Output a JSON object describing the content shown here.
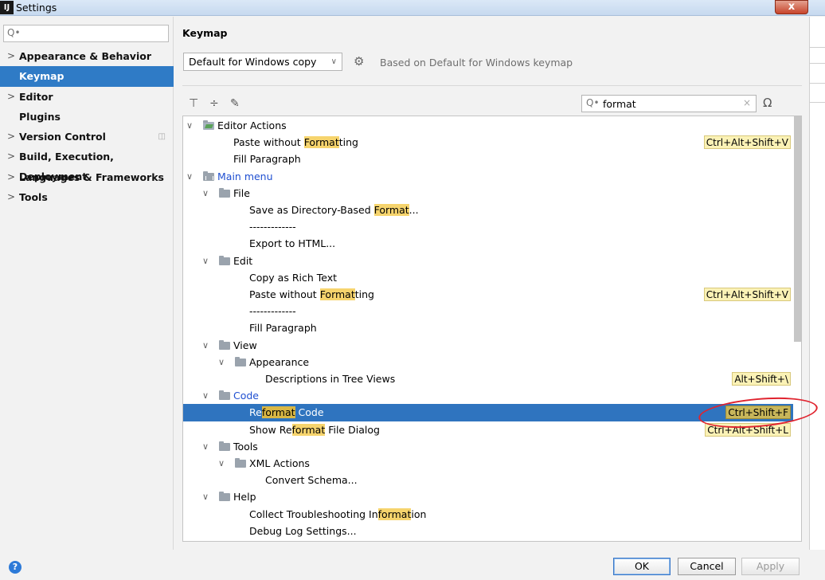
{
  "window": {
    "title": "Settings",
    "app_icon": "IJ",
    "close_glyph": "x"
  },
  "sidebar": {
    "search_icon": "Q•",
    "items": [
      {
        "label": "Appearance & Behavior",
        "chev": ">"
      },
      {
        "label": "Keymap",
        "chev": ""
      },
      {
        "label": "Editor",
        "chev": ">"
      },
      {
        "label": "Plugins",
        "chev": ""
      },
      {
        "label": "Version Control",
        "chev": ">"
      },
      {
        "label": "Build, Execution, Deployment",
        "chev": ">"
      },
      {
        "label": "Languages & Frameworks",
        "chev": ">"
      },
      {
        "label": "Tools",
        "chev": ">"
      }
    ]
  },
  "main": {
    "heading": "Keymap",
    "keymap_select": "Default for Windows copy",
    "based_on": "Based on Default for Windows keymap",
    "search": {
      "icon": "Q•",
      "value": "format"
    }
  },
  "tree": {
    "r0": {
      "chev": "∨",
      "label": "Editor Actions"
    },
    "r1": {
      "pre": "Paste without ",
      "hl": "Format",
      "post": "ting",
      "shortcut": "Ctrl+Alt+Shift+V"
    },
    "r2": {
      "label": "Fill Paragraph"
    },
    "r3": {
      "chev": "∨",
      "label": "Main menu"
    },
    "r4": {
      "chev": "∨",
      "label": "File"
    },
    "r5": {
      "pre": "Save as Directory-Based ",
      "hl": "Format",
      "post": "..."
    },
    "r6": {
      "label": "-------------"
    },
    "r7": {
      "label": "Export to HTML..."
    },
    "r8": {
      "chev": "∨",
      "label": "Edit"
    },
    "r9": {
      "label": "Copy as Rich Text"
    },
    "r10": {
      "pre": "Paste without ",
      "hl": "Format",
      "post": "ting",
      "shortcut": "Ctrl+Alt+Shift+V"
    },
    "r11": {
      "label": "-------------"
    },
    "r12": {
      "label": "Fill Paragraph"
    },
    "r13": {
      "chev": "∨",
      "label": "View"
    },
    "r14": {
      "chev": "∨",
      "label": "Appearance"
    },
    "r15": {
      "label": "Descriptions in Tree Views",
      "shortcut": "Alt+Shift+\\"
    },
    "r16": {
      "chev": "∨",
      "label": "Code"
    },
    "r17": {
      "pre": "Re",
      "hl": "format",
      "post": " Code",
      "shortcut": "Ctrl+Shift+F"
    },
    "r18": {
      "pre": "Show Re",
      "hl": "format",
      "post": " File Dialog",
      "shortcut": "Ctrl+Alt+Shift+L"
    },
    "r19": {
      "chev": "∨",
      "label": "Tools"
    },
    "r20": {
      "chev": "∨",
      "label": "XML Actions"
    },
    "r21": {
      "label": "Convert Schema..."
    },
    "r22": {
      "chev": "∨",
      "label": "Help"
    },
    "r23": {
      "pre": "Collect Troubleshooting In",
      "hl": "format",
      "post": "ion"
    },
    "r24": {
      "label": "Debug Log Settings..."
    }
  },
  "buttons": {
    "help": "?",
    "ok": "OK",
    "cancel": "Cancel",
    "apply": "Apply"
  }
}
